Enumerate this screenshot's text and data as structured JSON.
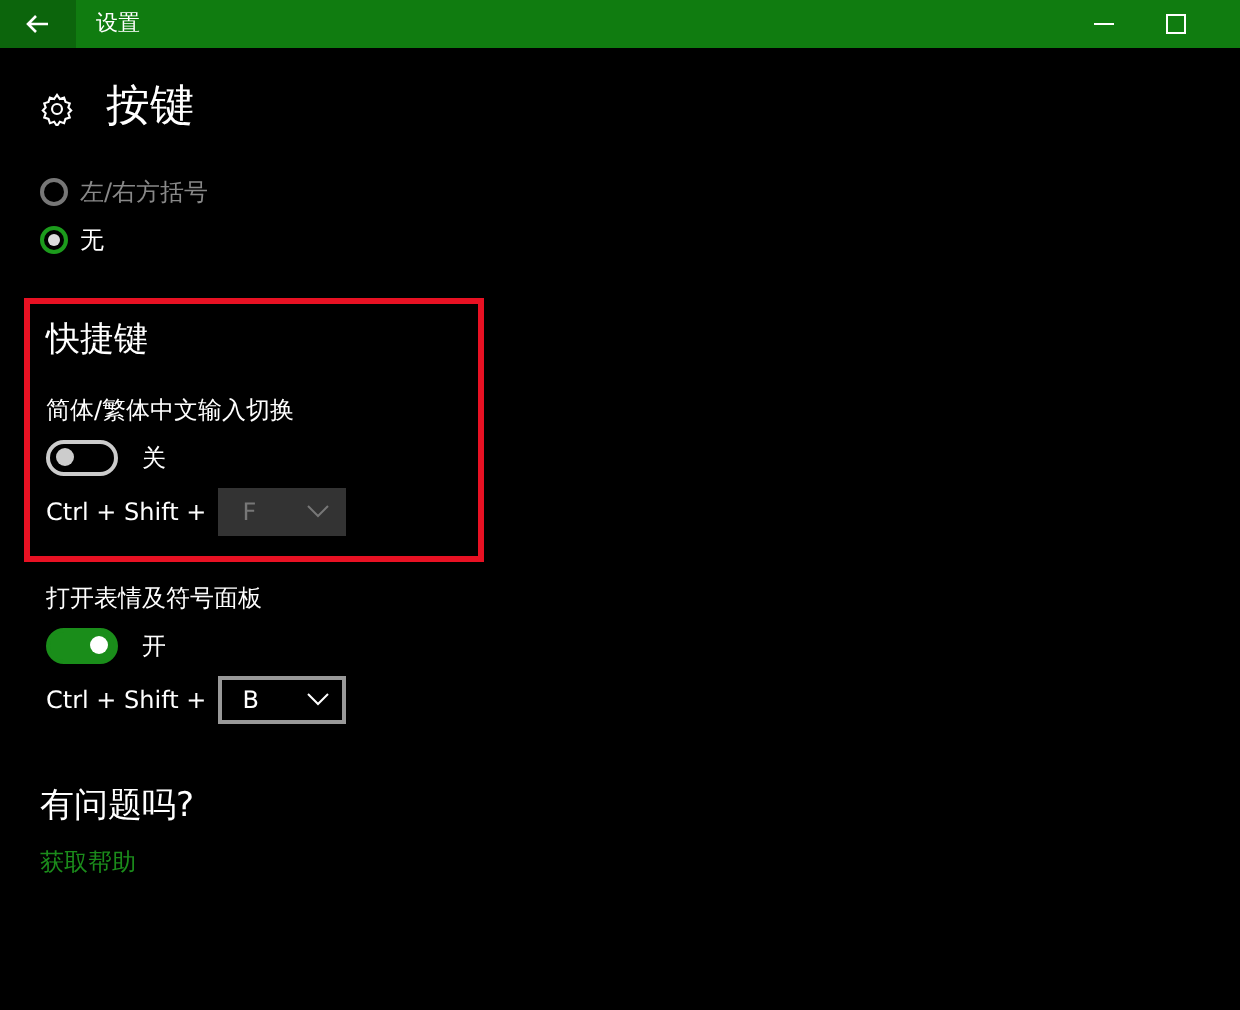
{
  "window": {
    "title": "设置"
  },
  "page": {
    "title": "按键"
  },
  "radios": [
    {
      "label": "左/右方括号",
      "selected": false
    },
    {
      "label": "无",
      "selected": true
    }
  ],
  "sections": [
    {
      "heading": "快捷键",
      "highlighted": true,
      "label": "简体/繁体中文输入切换",
      "on": false,
      "state_text": "关",
      "combo": "Ctrl + Shift +",
      "key": "F",
      "disabled": true
    },
    {
      "label": "打开表情及符号面板",
      "highlighted": false,
      "on": true,
      "state_text": "开",
      "combo": "Ctrl + Shift +",
      "key": "B",
      "disabled": false
    }
  ],
  "help": {
    "heading": "有问题吗?",
    "link": "获取帮助"
  }
}
